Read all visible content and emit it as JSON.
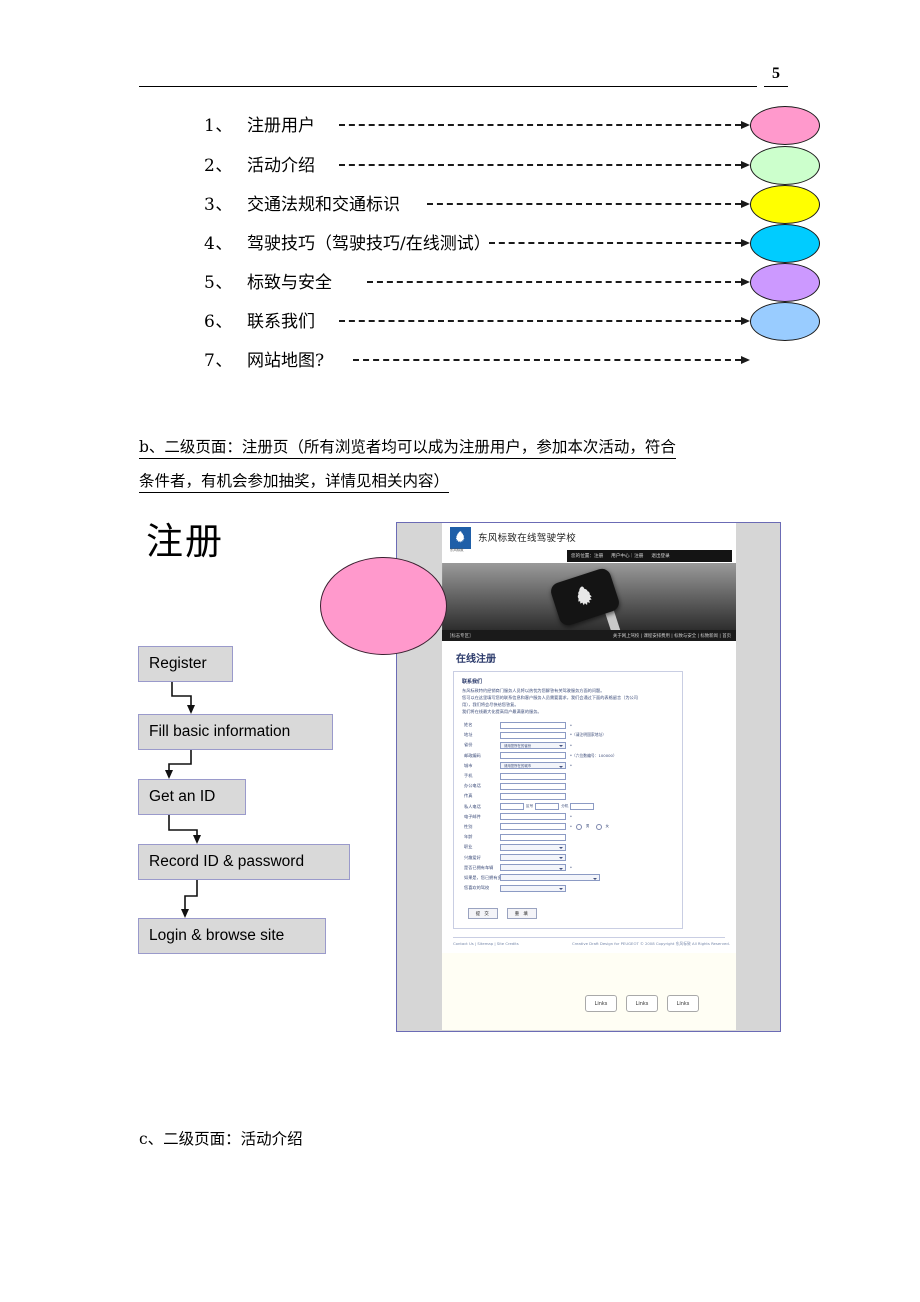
{
  "page": {
    "number": "5"
  },
  "nav_list": {
    "items": [
      {
        "num": "1、",
        "label": "注册用户",
        "ellipse_color": "#FF99CC",
        "has_ellipse": true
      },
      {
        "num": "2、",
        "label": "活动介绍",
        "ellipse_color": "#CCFFCC",
        "has_ellipse": true
      },
      {
        "num": "3、",
        "label": "交通法规和交通标识",
        "ellipse_color": "#FFFF00",
        "has_ellipse": true
      },
      {
        "num": "4、",
        "label": "驾驶技巧（驾驶技巧/在线测试）",
        "ellipse_color": "#00CCFF",
        "has_ellipse": true
      },
      {
        "num": "5、",
        "label": "标致与安全",
        "ellipse_color": "#CC99FF",
        "has_ellipse": true
      },
      {
        "num": "6、",
        "label": "联系我们",
        "ellipse_color": "#99CCFF",
        "has_ellipse": true
      },
      {
        "num": "7、",
        "label": "网站地图?",
        "ellipse_color": "",
        "has_ellipse": false
      }
    ]
  },
  "section_b": {
    "line1": "b、二级页面：注册页（所有浏览者均可以成为注册用户，参加本次活动，符合",
    "line2": "条件者，有机会参加抽奖，详情见相关内容）"
  },
  "zhuce_heading": "注册",
  "flowchart": {
    "boxes": [
      {
        "label": "Register"
      },
      {
        "label": "Fill basic information"
      },
      {
        "label": "Get an ID"
      },
      {
        "label": "Record ID & password"
      },
      {
        "label": "Login & browse site"
      }
    ]
  },
  "site_mock": {
    "title": "东风标致在线驾驶学校",
    "logo_sub": "东风标致",
    "user_bar": [
      "您的位置：注册",
      "用户中心｜注册",
      "退出登录"
    ],
    "nav_left": "［标志专区］",
    "nav_right": "关于网上驾校 | 课程安排费用 | 标致与安全 | 标致新闻 | 首页",
    "page_heading": "在线注册",
    "intro_title": "联系我们",
    "intro_lines": [
      "东风标致特约经销商门服务人员将以热忱为您解答有关驾驶服务方面的问题。",
      "您可以在这里填写您的联系信息和客户服务人员需要要求，我们会通过下面的表格留言（为公司",
      "用），我们将会尽快给您答复。",
      "我们将在线最大化提高用户最满意的服务。"
    ],
    "form_rows": [
      {
        "label": "姓名",
        "type": "input",
        "value": "",
        "hint": "*"
      },
      {
        "label": "地址",
        "type": "input",
        "value": "",
        "hint": "*（请注明国家地址）"
      },
      {
        "label": "省份",
        "type": "select",
        "value": "请用您所在的省份",
        "hint": "*"
      },
      {
        "label": "邮政编码",
        "type": "input",
        "value": "",
        "hint": "*（六位数编号：100000）"
      },
      {
        "label": "城市",
        "type": "select",
        "value": "请用您所在的城市",
        "hint": "*"
      },
      {
        "label": "手机",
        "type": "input",
        "value": "",
        "hint": ""
      },
      {
        "label": "办公电话",
        "type": "input",
        "value": "",
        "hint": ""
      },
      {
        "label": "传真",
        "type": "input",
        "value": "",
        "hint": ""
      },
      {
        "label": "私人电话",
        "type": "phone",
        "value": "",
        "hint": "",
        "sub1": "区号",
        "sub2": "分机"
      },
      {
        "label": "电子邮件",
        "type": "input",
        "value": "",
        "hint": "*"
      },
      {
        "label": "性别",
        "type": "gender",
        "value": "",
        "hint": "*",
        "opt1": "男",
        "opt2": "女"
      },
      {
        "label": "年龄",
        "type": "input",
        "value": "",
        "hint": ""
      },
      {
        "label": "职业",
        "type": "select",
        "value": "",
        "hint": ""
      },
      {
        "label": "兴趣爱好",
        "type": "select",
        "value": "",
        "hint": ""
      },
      {
        "label": "是否已拥有车辆",
        "type": "select",
        "value": "",
        "hint": "*"
      },
      {
        "label": "如果是，您已拥有多长时间了?",
        "type": "wideselect",
        "value": "",
        "hint": ""
      },
      {
        "label": "您喜欢的驾校",
        "type": "select",
        "value": "",
        "hint": ""
      }
    ],
    "buttons": [
      "提 交",
      "重 填"
    ],
    "footer_left": "Contact Us | Sitemap | Site Credits",
    "footer_right": "Creative Draft Design for PEUGEOT © 2008 Copyright 东风标致 All Rights Reserved.",
    "links_buttons": [
      "Links",
      "Links",
      "Links"
    ]
  },
  "section_c": "c、二级页面：活动介绍",
  "colors": {
    "flow_box_fill": "#D9D9D9",
    "flow_box_border": "#9A9ACB",
    "callout_pink": "#FF99CC",
    "mock_frame_border": "#6B6BB5"
  }
}
